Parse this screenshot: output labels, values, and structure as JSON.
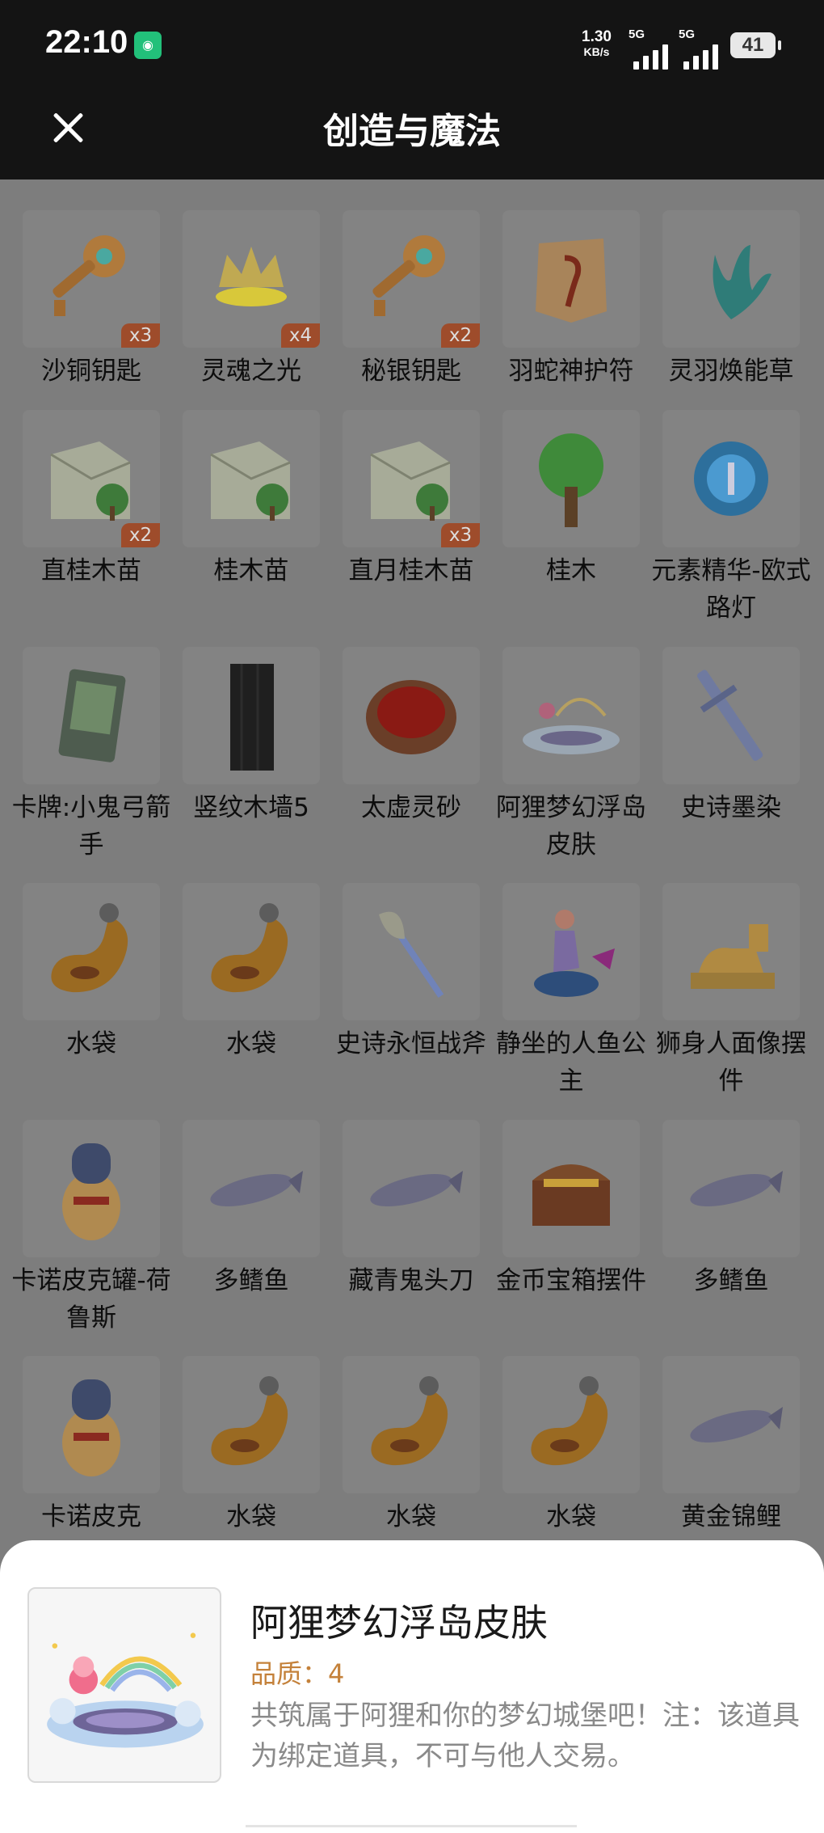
{
  "status_bar": {
    "time": "22:10",
    "net_speed_value": "1.30",
    "net_speed_unit": "KB/s",
    "signal_1_tag": "5G",
    "signal_2_tag": "5G",
    "battery": "41"
  },
  "header": {
    "title": "创造与魔法"
  },
  "grid": {
    "partial_row": [
      "",
      "",
      "",
      "",
      ""
    ],
    "items": [
      {
        "name": "沙铜钥匙",
        "count": "x3",
        "icon": "key-icon"
      },
      {
        "name": "灵魂之光",
        "count": "x4",
        "icon": "crown-light-icon"
      },
      {
        "name": "秘银钥匙",
        "count": "x2",
        "icon": "key-icon"
      },
      {
        "name": "羽蛇神护符",
        "count": "",
        "icon": "amulet-icon"
      },
      {
        "name": "灵羽焕能草",
        "count": "",
        "icon": "plant-icon"
      },
      {
        "name": "直桂木苗",
        "count": "x2",
        "icon": "seed-bag-icon"
      },
      {
        "name": "桂木苗",
        "count": "",
        "icon": "seed-bag-icon"
      },
      {
        "name": "直月桂木苗",
        "count": "x3",
        "icon": "seed-bag-icon"
      },
      {
        "name": "桂木",
        "count": "",
        "icon": "tree-icon"
      },
      {
        "name": "元素精华-欧式路灯",
        "count": "",
        "icon": "orb-icon"
      },
      {
        "name": "卡牌:小鬼弓箭手",
        "count": "",
        "icon": "card-icon"
      },
      {
        "name": "竖纹木墙5",
        "count": "",
        "icon": "wall-icon"
      },
      {
        "name": "太虚灵砂",
        "count": "",
        "icon": "bowl-icon"
      },
      {
        "name": "阿狸梦幻浮岛皮肤",
        "count": "",
        "icon": "island-icon"
      },
      {
        "name": "史诗墨染",
        "count": "",
        "icon": "sword-icon"
      },
      {
        "name": "水袋",
        "count": "",
        "icon": "water-bag-icon"
      },
      {
        "name": "水袋",
        "count": "",
        "icon": "water-bag-icon"
      },
      {
        "name": "史诗永恒战斧",
        "count": "",
        "icon": "axe-icon"
      },
      {
        "name": "静坐的人鱼公主",
        "count": "",
        "icon": "mermaid-icon"
      },
      {
        "name": "狮身人面像摆件",
        "count": "",
        "icon": "sphinx-icon"
      },
      {
        "name": "卡诺皮克罐-荷鲁斯",
        "count": "",
        "icon": "canopic-jar-icon"
      },
      {
        "name": "多鳍鱼",
        "count": "",
        "icon": "fish-icon"
      },
      {
        "name": "藏青鬼头刀",
        "count": "",
        "icon": "fish-icon"
      },
      {
        "name": "金币宝箱摆件",
        "count": "",
        "icon": "chest-icon"
      },
      {
        "name": "多鳍鱼",
        "count": "",
        "icon": "fish-icon"
      },
      {
        "name": "卡诺皮克",
        "count": "",
        "icon": "canopic-jar-icon"
      },
      {
        "name": "水袋",
        "count": "",
        "icon": "water-bag-icon"
      },
      {
        "name": "水袋",
        "count": "",
        "icon": "water-bag-icon"
      },
      {
        "name": "水袋",
        "count": "",
        "icon": "water-bag-icon"
      },
      {
        "name": "黄金锦鲤",
        "count": "",
        "icon": "fish-icon"
      }
    ]
  },
  "detail": {
    "name": "阿狸梦幻浮岛皮肤",
    "quality": "品质：4",
    "description": "共筑属于阿狸和你的梦幻城堡吧！注：该道具为绑定道具，不可与他人交易。",
    "icon": "island-icon"
  },
  "colors": {
    "overlay": "#7d7d7d",
    "header": "#141414",
    "quality": "#c4813a",
    "badge": "#9e4c2b"
  }
}
